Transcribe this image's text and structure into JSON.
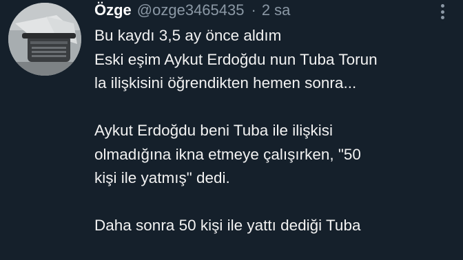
{
  "tweet": {
    "author_name": "Özge",
    "handle": "@ozge3465435",
    "separator": "·",
    "time": "2 sa",
    "lines": [
      "Bu kaydı 3,5 ay önce aldım",
      "Eski eşim Aykut Erdoğdu nun Tuba Torun",
      "la ilişkisini öğrendikten hemen sonra...",
      "",
      "Aykut Erdoğdu beni Tuba ile ilişkisi",
      "olmadığına ikna etmeye çalışırken, \"50",
      "kişi ile yatmış\" dedi.",
      "",
      "Daha sonra 50 kişi ile yattı dediği Tuba"
    ]
  },
  "icons": {
    "avatar": "avatar-typewriter-photo",
    "more": "more-options-icon"
  },
  "colors": {
    "background": "#15202b",
    "text": "#ffffff",
    "secondary": "#8b98a5"
  }
}
